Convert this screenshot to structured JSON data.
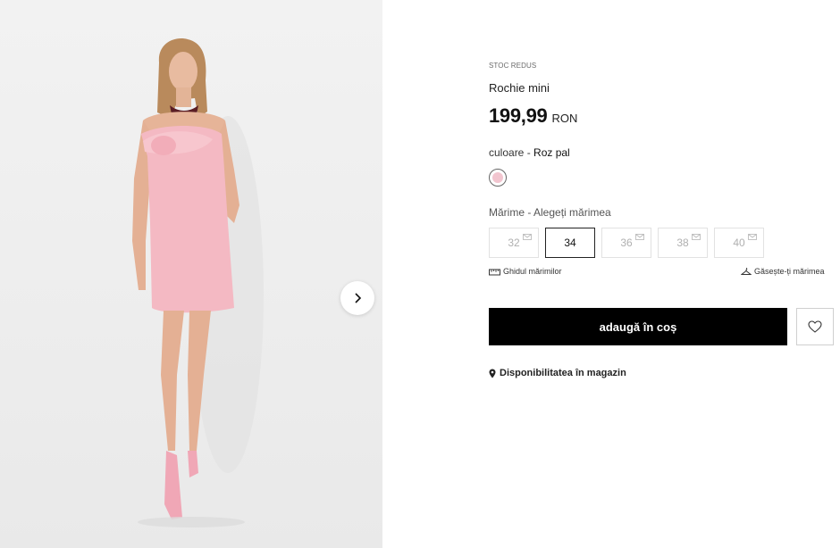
{
  "gallery": {
    "next_label": "next-image"
  },
  "product": {
    "stock_label": "STOC REDUS",
    "title": "Rochie mini",
    "price_value": "199,99",
    "price_currency": "RON"
  },
  "color": {
    "label": "culoare - ",
    "value": "Roz pal",
    "swatch_hex": "#f2c5cf"
  },
  "size": {
    "label": "Mărime - Alegeți mărimea",
    "options": [
      {
        "label": "32",
        "available": false,
        "selected": false
      },
      {
        "label": "34",
        "available": true,
        "selected": true
      },
      {
        "label": "36",
        "available": false,
        "selected": false
      },
      {
        "label": "38",
        "available": false,
        "selected": false
      },
      {
        "label": "40",
        "available": false,
        "selected": false
      }
    ],
    "guide_label": "Ghidul mărimilor",
    "find_label": "Găsește-ți mărimea"
  },
  "actions": {
    "add_to_cart": "adaugă în coș"
  },
  "availability": {
    "label": "Disponibilitatea în magazin"
  },
  "colors": {
    "button_bg": "#000000",
    "dress_pink": "#f4b9c3"
  }
}
